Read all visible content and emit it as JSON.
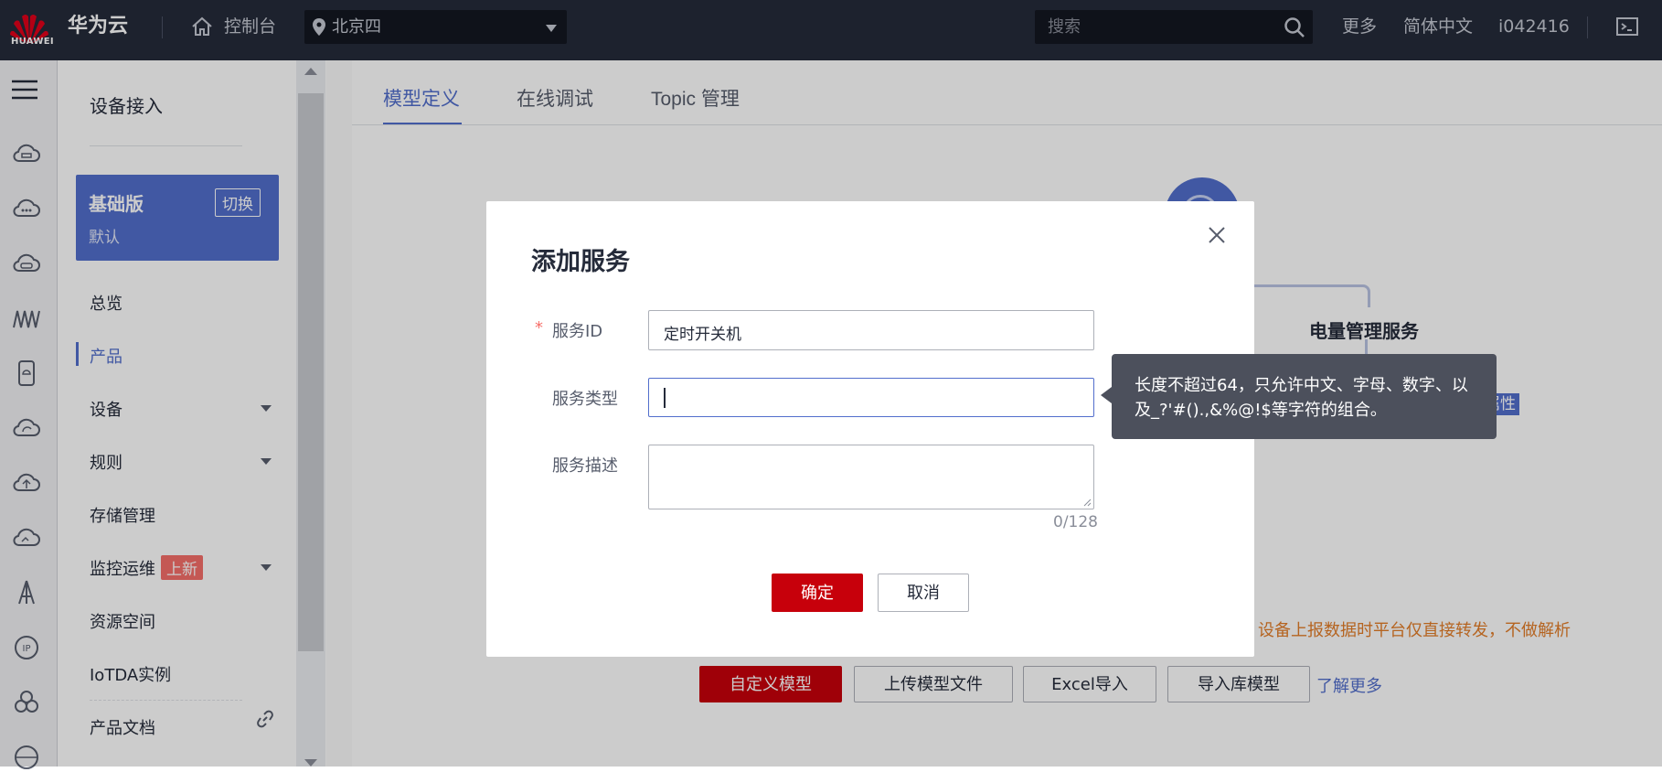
{
  "topbar": {
    "logo_text": "HUAWEI",
    "brand": "华为云",
    "console": "控制台",
    "region": "北京四",
    "search_placeholder": "搜索",
    "more": "更多",
    "language": "简体中文",
    "user": "i042416"
  },
  "sidenav": {
    "title": "设备接入",
    "edition": {
      "name": "基础版",
      "switch_label": "切换",
      "sub": "默认"
    },
    "items": [
      {
        "label": "总览"
      },
      {
        "label": "产品",
        "active": true
      },
      {
        "label": "设备",
        "caret": true
      },
      {
        "label": "规则",
        "caret": true
      },
      {
        "label": "存储管理"
      },
      {
        "label": "监控运维",
        "badge": "上新",
        "caret": true
      },
      {
        "label": "资源空间"
      },
      {
        "label": "IoTDA实例"
      },
      {
        "label": "产品文档"
      }
    ]
  },
  "main": {
    "tabs": [
      {
        "label": "模型定义",
        "active": true
      },
      {
        "label": "在线调试"
      },
      {
        "label": "Topic 管理"
      }
    ],
    "bg_service_name": "电量管理服务",
    "bg_property_tag": "属性",
    "notice": "设备上报数据时平台仅直接转发，不做解析",
    "buttons": {
      "custom_model": "自定义模型",
      "upload_model": "上传模型文件",
      "excel_import": "Excel导入",
      "import_lib": "导入库模型"
    },
    "learn_more": "了解更多"
  },
  "dialog": {
    "title": "添加服务",
    "fields": {
      "service_id": {
        "label": "服务ID",
        "value": "定时开关机",
        "required": true
      },
      "service_type": {
        "label": "服务类型",
        "value": ""
      },
      "service_desc": {
        "label": "服务描述",
        "value": "",
        "counter": "0/128"
      }
    },
    "confirm": "确定",
    "cancel": "取消"
  },
  "tooltip": {
    "line1": "长度不超过64，只允许中文、字母、数字、以",
    "line2": "及_?'#().,&%@!$等字符的组合。"
  },
  "colors": {
    "topbar": "#252b3a",
    "primary_red": "#c7000b",
    "edition_blue": "#526ecc",
    "tab_active": "#526ecc",
    "notice_orange": "#e37d29",
    "badge_red": "#f66f6a"
  }
}
